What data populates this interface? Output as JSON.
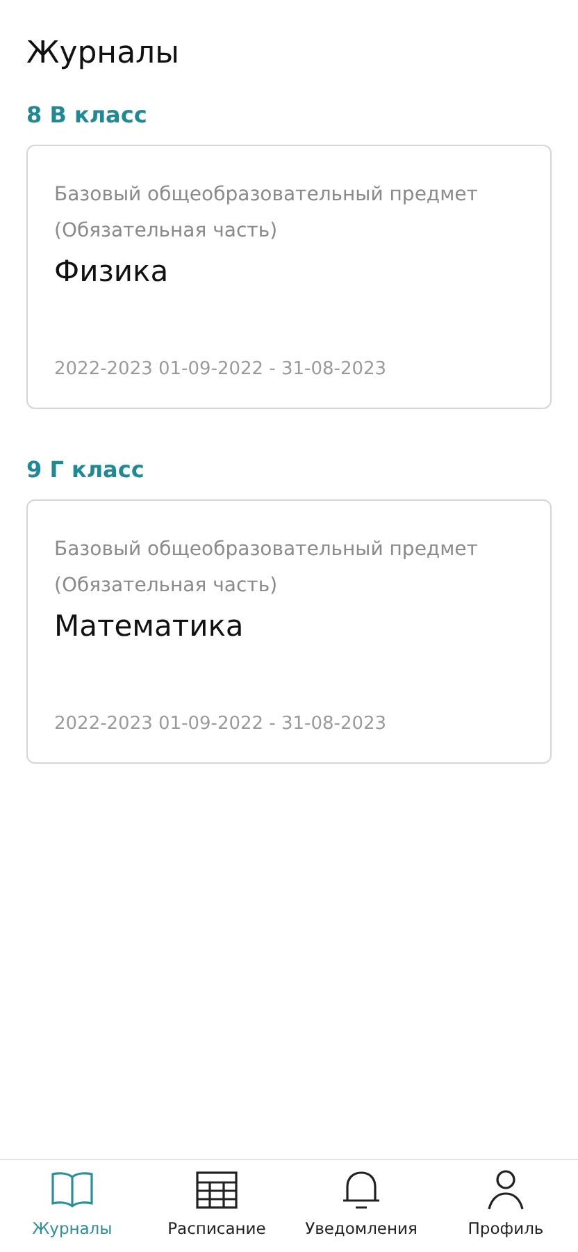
{
  "title": "Журналы",
  "groups": [
    {
      "class": "8 В класс",
      "card": {
        "category": "Базовый общеобразовательный предмет (Обязательная часть)",
        "subject": "Физика",
        "period": "2022-2023 01-09-2022 - 31-08-2023"
      }
    },
    {
      "class": "9 Г класс",
      "card": {
        "category": "Базовый общеобразовательный предмет (Обязательная часть)",
        "subject": "Математика",
        "period": "2022-2023 01-09-2022 - 31-08-2023"
      }
    }
  ],
  "nav": [
    {
      "kind": "book",
      "label": "Журналы",
      "selected": true
    },
    {
      "kind": "grid",
      "label": "Расписание",
      "selected": false
    },
    {
      "kind": "bell",
      "label": "Уведомления",
      "selected": false
    },
    {
      "kind": "person",
      "label": "Профиль",
      "selected": false
    }
  ]
}
